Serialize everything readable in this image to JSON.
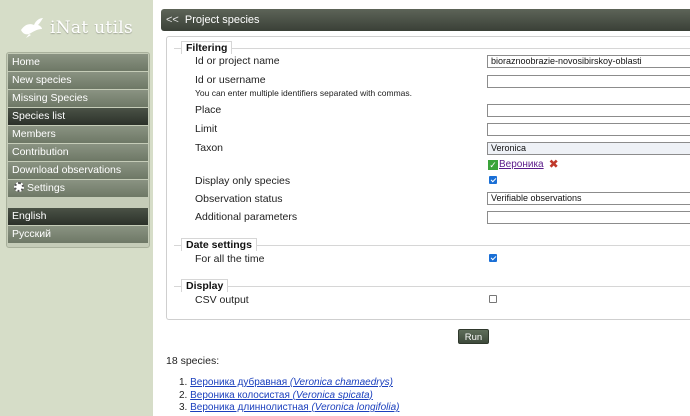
{
  "app": {
    "title": "iNat utils"
  },
  "sidebar": {
    "items": [
      {
        "label": "Home"
      },
      {
        "label": "New species"
      },
      {
        "label": "Missing Species"
      },
      {
        "label": "Species list"
      },
      {
        "label": "Members"
      },
      {
        "label": "Contribution"
      },
      {
        "label": "Download observations"
      },
      {
        "label": "Settings"
      }
    ],
    "active": "Species list",
    "languages": [
      {
        "label": "English"
      },
      {
        "label": "Русский"
      }
    ],
    "active_language": "English"
  },
  "header": {
    "chevron": "<<",
    "title": "Project species"
  },
  "filtering": {
    "legend": "Filtering",
    "project_label": "Id or project name",
    "project_value": "bioraznoobrazie-novosibirskoy-oblasti",
    "user_label": "Id or username",
    "user_hint": "You can enter multiple identifiers separated with commas.",
    "user_value": "",
    "place_label": "Place",
    "place_value": "",
    "limit_label": "Limit",
    "limit_value": "",
    "taxon_label": "Taxon",
    "taxon_value": "Veronica",
    "taxon_chip": "Вероника",
    "taxon_chip_check": "✓",
    "taxon_chip_remove": "✖",
    "only_species_label": "Display only species",
    "only_species_checked": true,
    "obs_status_label": "Observation status",
    "obs_status_value": "Verifiable observations",
    "additional_label": "Additional parameters",
    "additional_value": ""
  },
  "date_settings": {
    "legend": "Date settings",
    "all_time_label": "For all the time",
    "all_time_checked": true
  },
  "display": {
    "legend": "Display",
    "csv_label": "CSV output",
    "csv_checked": false
  },
  "run_label": "Run",
  "results": {
    "count_text": "18 species:",
    "species": [
      {
        "num": "1.",
        "common": "Вероника дубравная",
        "latin": "(Veronica chamaedrys)"
      },
      {
        "num": "2.",
        "common": "Вероника колосистая",
        "latin": "(Veronica spicata)"
      },
      {
        "num": "3.",
        "common": "Вероника длиннолистная",
        "latin": "(Veronica longifolia)"
      }
    ]
  },
  "colors": {
    "accent": "#1a6fd6",
    "sidebar_bg": "#d6ddc8",
    "nav_active": "#2c312a",
    "link": "#1a3fbd"
  }
}
